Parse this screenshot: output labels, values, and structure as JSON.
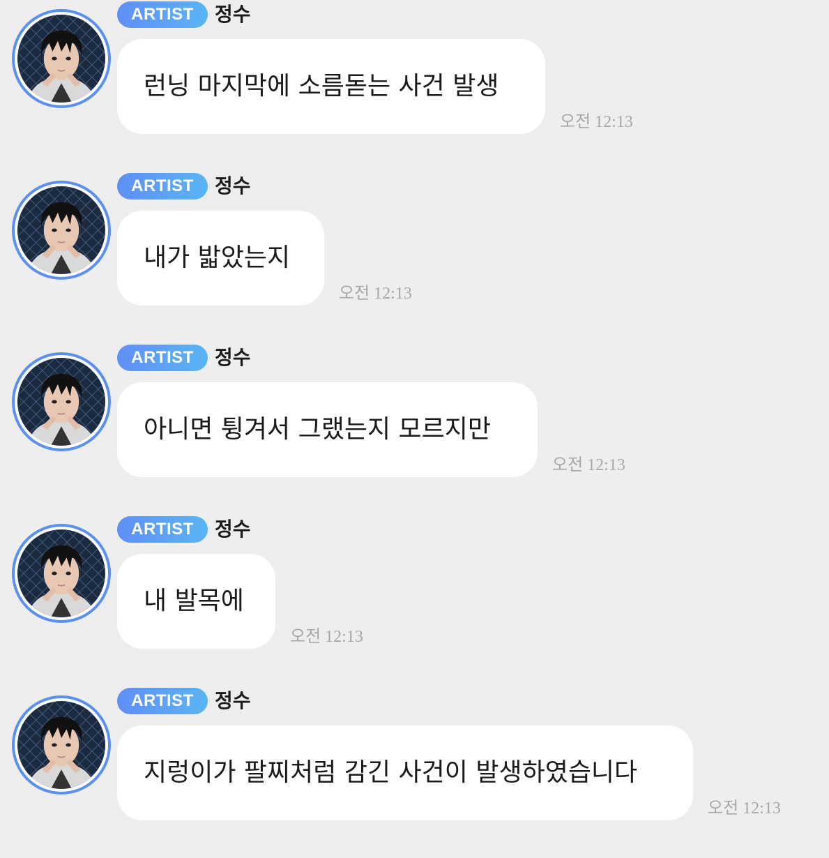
{
  "chat": {
    "messages": [
      {
        "badge": "ARTIST",
        "sender": "정수",
        "text": "런닝 마지막에 소름돋는 사건 발생",
        "time": "오전 12:13",
        "avatar": "profile-photo"
      },
      {
        "badge": "ARTIST",
        "sender": "정수",
        "text": "내가 밟았는지",
        "time": "오전 12:13",
        "avatar": "profile-photo"
      },
      {
        "badge": "ARTIST",
        "sender": "정수",
        "text": "아니면 튕겨서 그랬는지 모르지만",
        "time": "오전 12:13",
        "avatar": "profile-photo"
      },
      {
        "badge": "ARTIST",
        "sender": "정수",
        "text": "내 발목에",
        "time": "오전 12:13",
        "avatar": "profile-photo"
      },
      {
        "badge": "ARTIST",
        "sender": "정수",
        "text": "지렁이가 팔찌처럼 감긴 사건이 발생하였습니다",
        "time": "오전 12:13",
        "avatar": "profile-photo"
      }
    ]
  },
  "colors": {
    "background": "#eeeeee",
    "bubble": "#ffffff",
    "badge_start": "#5f8ff6",
    "badge_end": "#5ab5f2",
    "avatar_ring": "#5b8ff0",
    "timestamp": "#a7a7a7"
  }
}
